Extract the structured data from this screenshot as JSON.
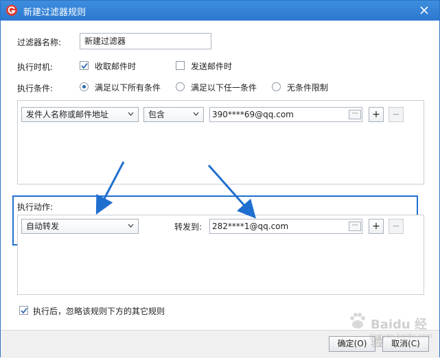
{
  "window": {
    "title": "新建过滤器规则",
    "close_icon": "close-icon",
    "logo_icon": "app-logo-icon",
    "accent_color": "#2c78cf"
  },
  "form": {
    "name_label": "过滤器名称:",
    "name_value": "新建过滤器",
    "timing_label": "执行时机:",
    "timing_options": [
      {
        "label": "收取邮件时",
        "checked": true
      },
      {
        "label": "发送邮件时",
        "checked": false
      }
    ],
    "condition_label": "执行条件:",
    "condition_options": [
      {
        "label": "满足以下所有条件",
        "selected": true
      },
      {
        "label": "满足以下任一条件",
        "selected": false
      },
      {
        "label": "无条件限制",
        "selected": false
      }
    ]
  },
  "condition_row": {
    "field_select": "发件人名称或邮件地址",
    "operator_select": "包含",
    "value": "390****69@qq.com",
    "ellipsis": "···",
    "add": "+",
    "remove": "−"
  },
  "action": {
    "label": "执行动作:",
    "action_select": "自动转发",
    "forward_label": "转发到:",
    "forward_value": "282****1@qq.com",
    "ellipsis": "···",
    "add": "+",
    "remove": "−"
  },
  "footer": {
    "ignore_label": "执行后，忽略该规则下方的其它规则",
    "ignore_checked": true,
    "ok_button": "确定(O)",
    "cancel_button": "取消(C)"
  },
  "annotations": {
    "arrow_color": "#1f6fcf",
    "highlight_color": "#1f6fcf"
  },
  "watermark": {
    "text": "Baidu 经验",
    "sub": "jingyan.baidu.com"
  }
}
